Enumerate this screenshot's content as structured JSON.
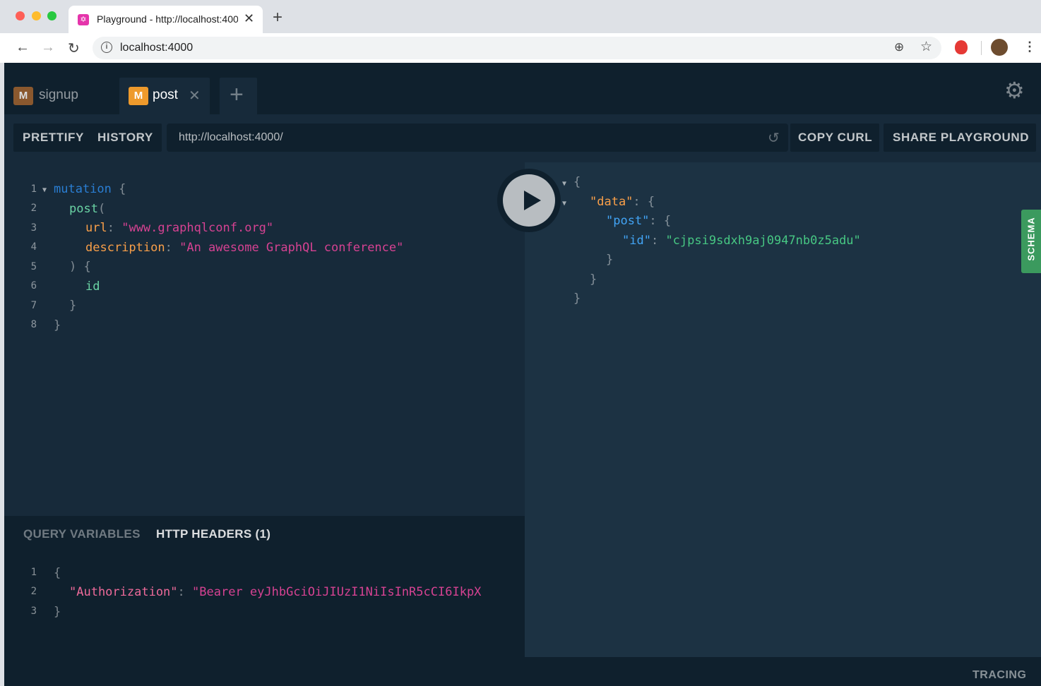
{
  "browser": {
    "tab_title": "Playground - http://localhost:4000",
    "address": "localhost:4000",
    "new_tab_glyph": "+",
    "close_glyph": "✕"
  },
  "playground": {
    "tabs": [
      {
        "badge": "M",
        "label": "signup"
      },
      {
        "badge": "M",
        "label": "post"
      }
    ],
    "add_tab_glyph": "+",
    "toolbar": {
      "prettify": "PRETTIFY",
      "history": "HISTORY",
      "endpoint": "http://localhost:4000/",
      "copy_curl": "COPY CURL",
      "share": "SHARE PLAYGROUND"
    },
    "query_lines": [
      "1",
      "2",
      "3",
      "4",
      "5",
      "6",
      "7",
      "8"
    ],
    "query": {
      "l1_kw": "mutation",
      "l1_brace": "{",
      "l2_field": "post",
      "l2_paren": "(",
      "l3_arg": "url",
      "l3_colon": ":",
      "l3_value": "\"www.graphqlconf.org\"",
      "l4_arg": "description",
      "l4_colon": ":",
      "l4_value": "\"An awesome GraphQL conference\"",
      "l5": ") {",
      "l6_field": "id",
      "l7": "}",
      "l8": "}"
    },
    "result": {
      "open": "{",
      "data_key": "\"data\"",
      "data_rest": ": {",
      "post_key": "\"post\"",
      "post_rest": ": {",
      "id_key": "\"id\"",
      "id_colon": ": ",
      "id_value": "\"cjpsi9sdxh9aj0947nb0z5adu\"",
      "close1": "}",
      "close2": "}",
      "close3": "}"
    },
    "schema_label": "SCHEMA",
    "bottom": {
      "tab_variables": "QUERY VARIABLES",
      "tab_headers": "HTTP HEADERS (1)",
      "lines": [
        "1",
        "2",
        "3"
      ],
      "open": "{",
      "auth_key": "\"Authorization\"",
      "auth_colon": ": ",
      "auth_value": "\"Bearer eyJhbGciOiJIUzI1NiIsInR5cCI6IkpX",
      "close": "}"
    },
    "tracing": "TRACING"
  }
}
